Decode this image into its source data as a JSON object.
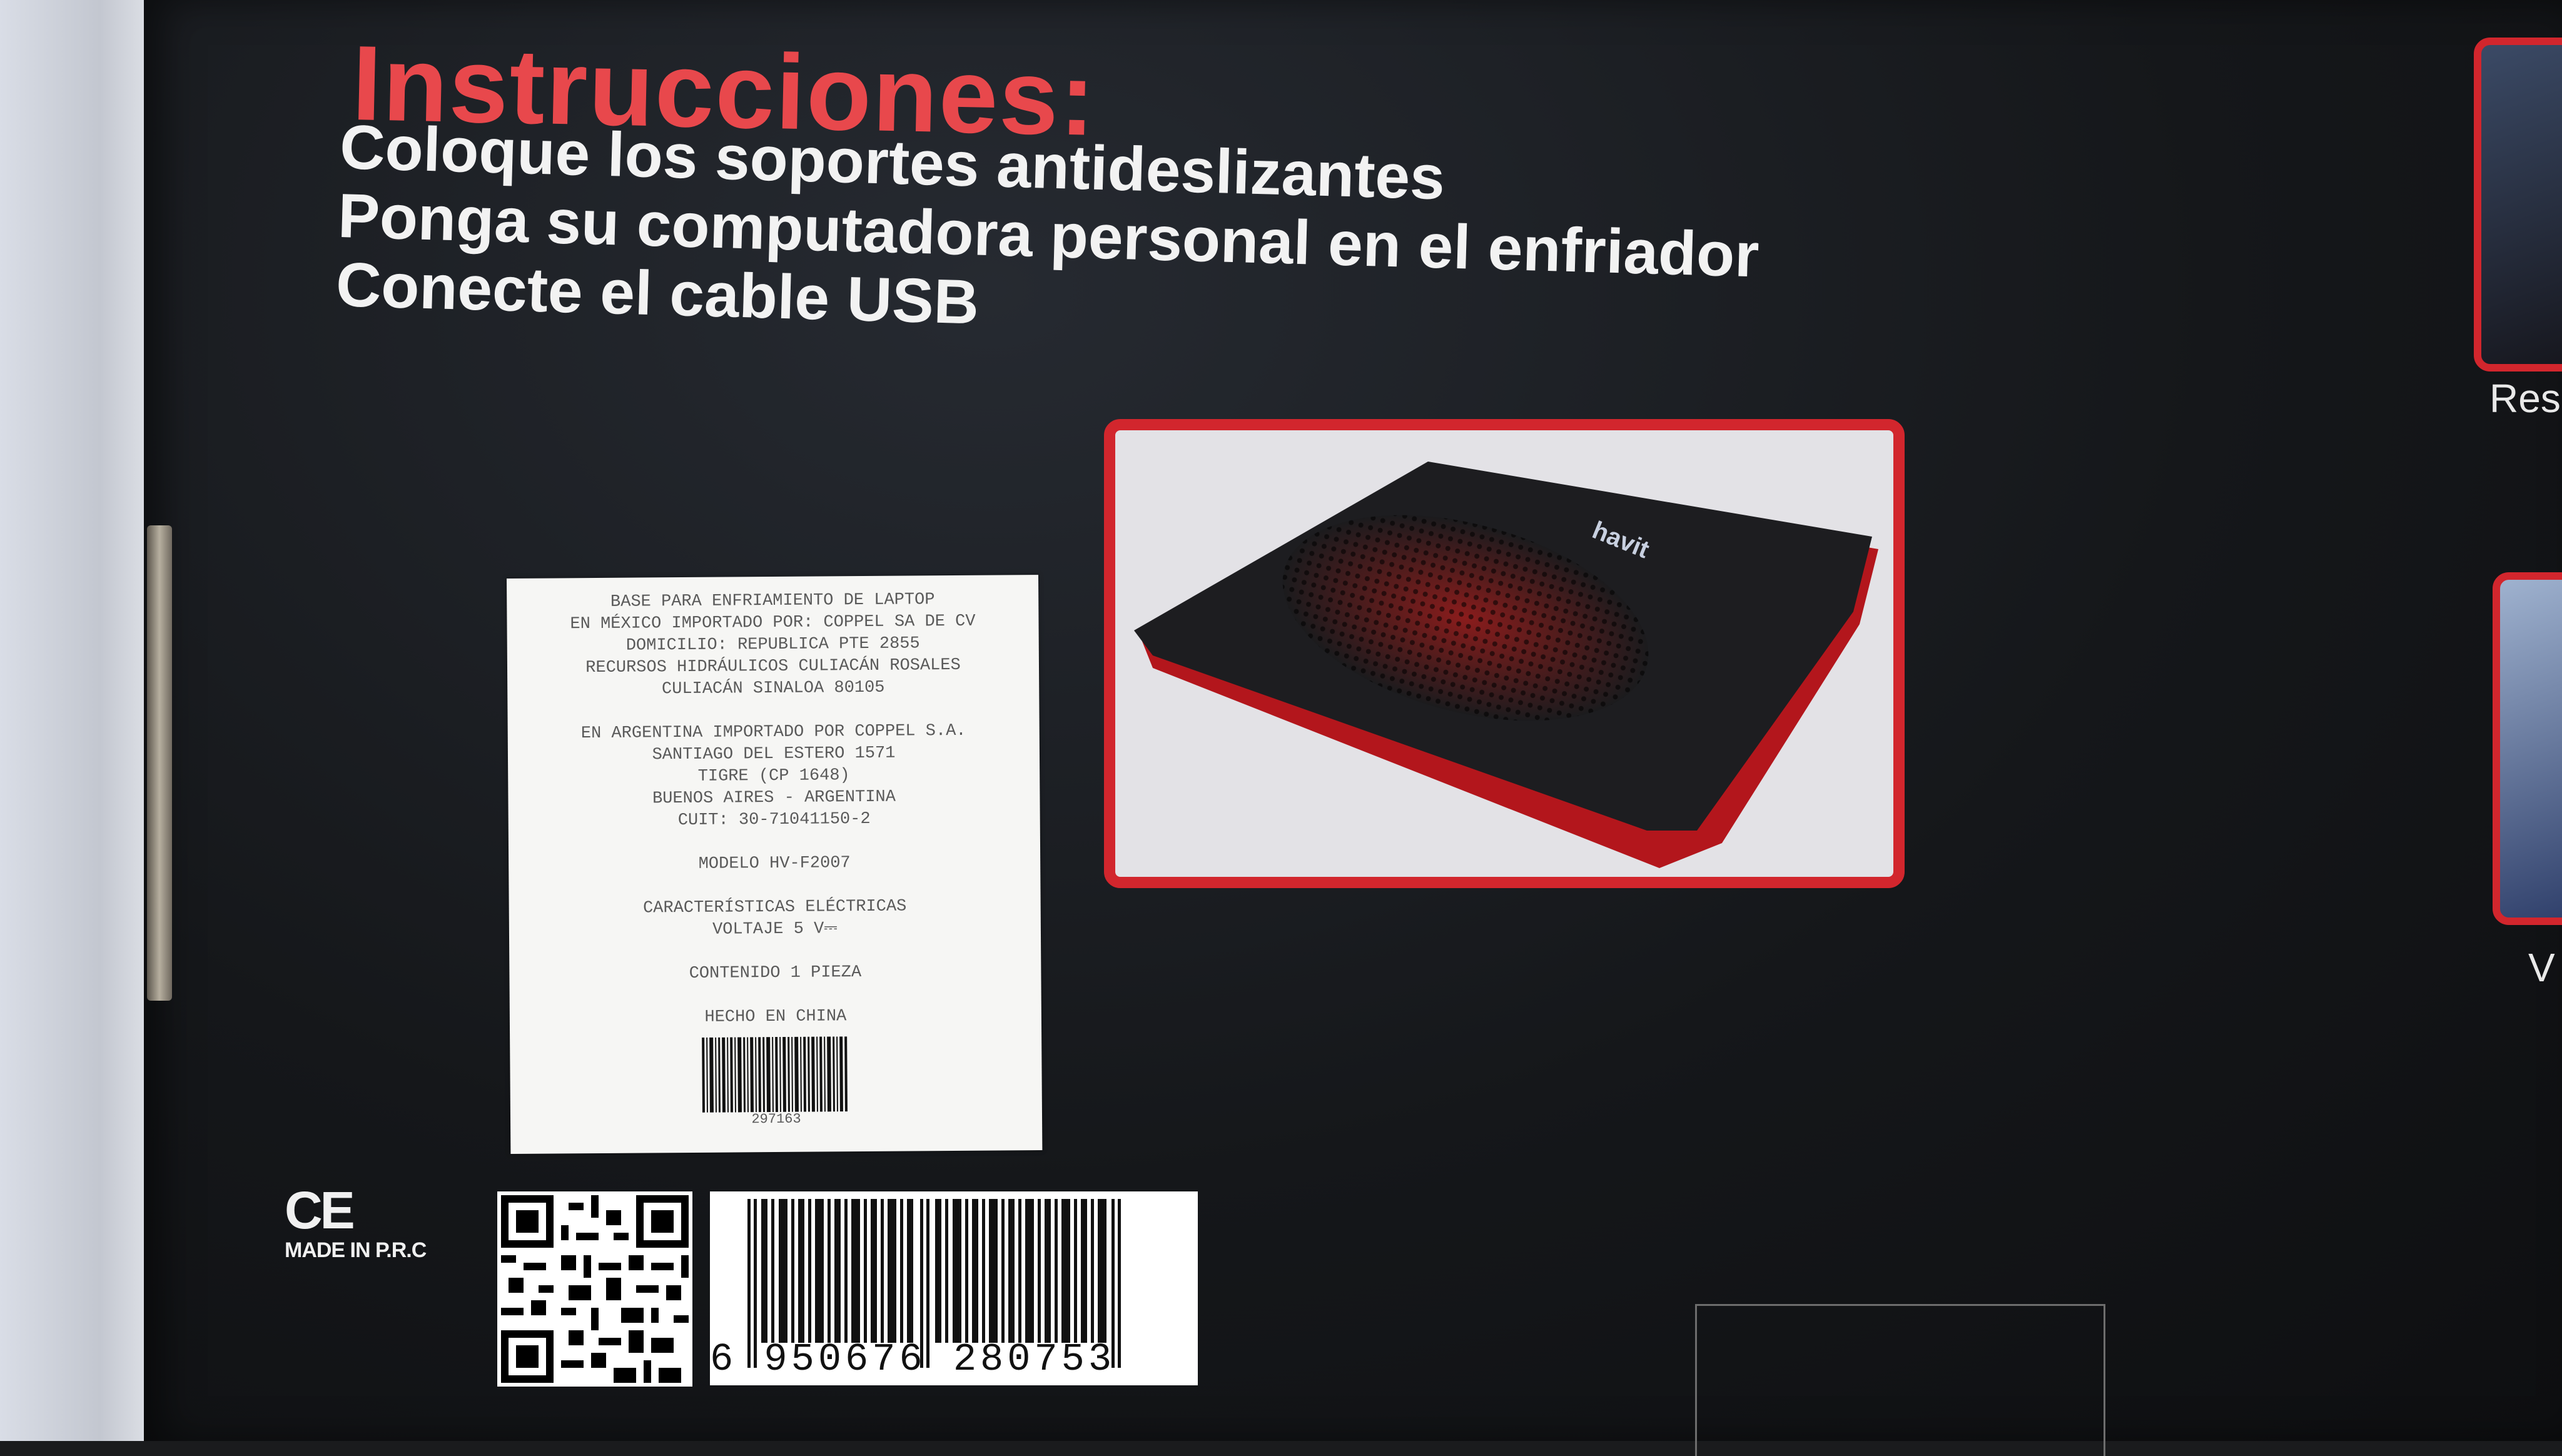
{
  "instructions": {
    "title": "Instrucciones:",
    "steps": [
      "Coloque los soportes antideslizantes",
      "Ponga su computadora personal en el enfriador",
      "Conecte el cable USB"
    ]
  },
  "product_photo": {
    "brand": "havit"
  },
  "import_label": {
    "lines": [
      "BASE PARA ENFRIAMIENTO DE LAPTOP",
      "",
      "EN MÉXICO IMPORTADO POR: COPPEL SA DE CV",
      "DOMICILIO: REPUBLICA PTE 2855",
      "RECURSOS HIDRÁULICOS CULIACÁN ROSALES",
      "CULIACÁN SINALOA 80105",
      "",
      "EN ARGENTINA IMPORTADO POR COPPEL S.A.",
      "SANTIAGO DEL ESTERO 1571",
      "TIGRE (CP 1648)",
      "BUENOS AIRES - ARGENTINA",
      "CUIT: 30-71041150-2",
      "",
      "MODELO HV-F2007",
      "",
      "CARACTERÍSTICAS ELÉCTRICAS",
      "VOLTAJE 5 V⎓",
      "",
      "CONTENIDO 1 PIEZA",
      "",
      "HECHO EN CHINA"
    ],
    "barcode_number": "297163"
  },
  "ce": {
    "mark": "CE",
    "made_in": "MADE IN P.R.C"
  },
  "ean": {
    "digits": "6 950676 280753"
  },
  "right_side": {
    "text_1": "Res",
    "text_2": "V"
  },
  "colors": {
    "accent_red": "#d2262d",
    "title_red": "#e8484c"
  }
}
